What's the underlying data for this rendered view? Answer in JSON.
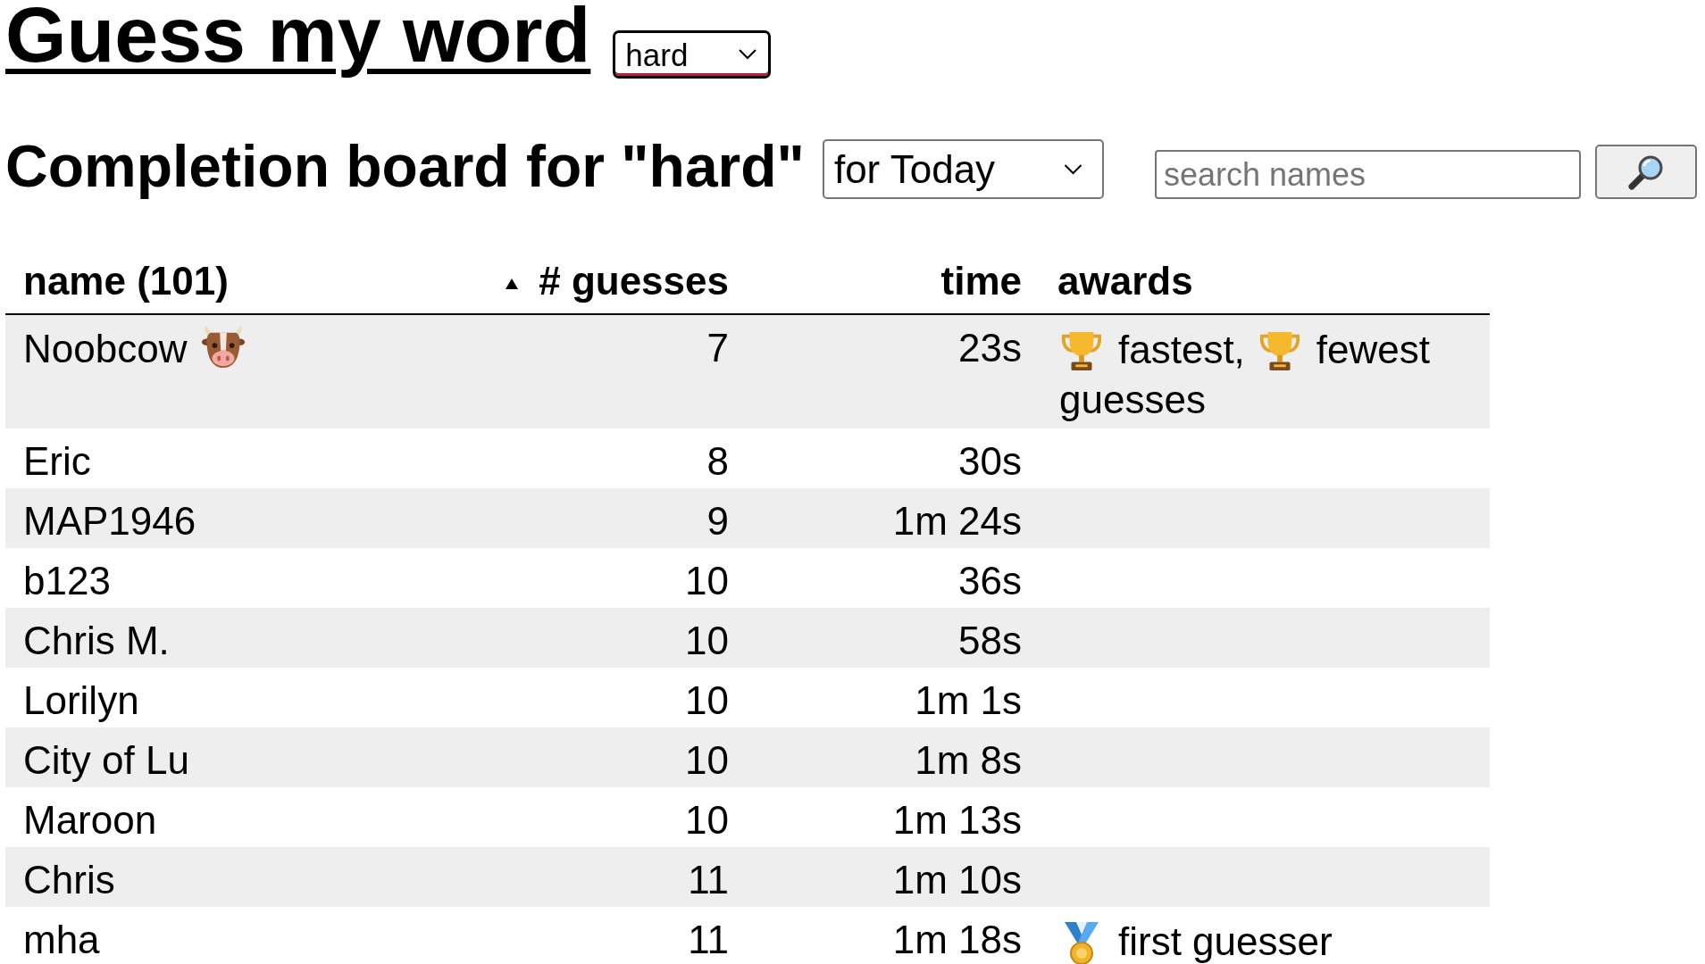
{
  "header": {
    "title": "Guess my word",
    "difficulty": "hard"
  },
  "board": {
    "heading": "Completion board for \"hard\"",
    "period": "for Today",
    "search": {
      "placeholder": "search names"
    }
  },
  "table": {
    "columns": [
      {
        "label": "name (101)",
        "sorted": false
      },
      {
        "label": "# guesses",
        "sorted": true
      },
      {
        "label": "time",
        "sorted": false
      },
      {
        "label": "awards",
        "sorted": false
      }
    ],
    "rows": [
      {
        "name": "Noobcow",
        "badge": true,
        "guesses": "7",
        "time": "23s",
        "awards": [
          {
            "kind": "trophy",
            "label": "fastest,"
          },
          {
            "kind": "trophy",
            "label": "fewest guesses"
          }
        ]
      },
      {
        "name": "Eric",
        "badge": false,
        "guesses": "8",
        "time": "30s"
      },
      {
        "name": "MAP1946",
        "badge": false,
        "guesses": "9",
        "time": "1m 24s"
      },
      {
        "name": "b123",
        "badge": false,
        "guesses": "10",
        "time": "36s"
      },
      {
        "name": "Chris M.",
        "badge": false,
        "guesses": "10",
        "time": "58s"
      },
      {
        "name": "Lorilyn",
        "badge": false,
        "guesses": "10",
        "time": "1m 1s"
      },
      {
        "name": "City of Lu",
        "badge": false,
        "guesses": "10",
        "time": "1m 8s"
      },
      {
        "name": "Maroon",
        "badge": false,
        "guesses": "10",
        "time": "1m 13s"
      },
      {
        "name": "Chris",
        "badge": false,
        "guesses": "11",
        "time": "1m 10s"
      },
      {
        "name": "mha",
        "badge": false,
        "guesses": "11",
        "time": "1m 18s",
        "awards": [
          {
            "kind": "medal",
            "label": "first guesser"
          }
        ]
      }
    ]
  }
}
